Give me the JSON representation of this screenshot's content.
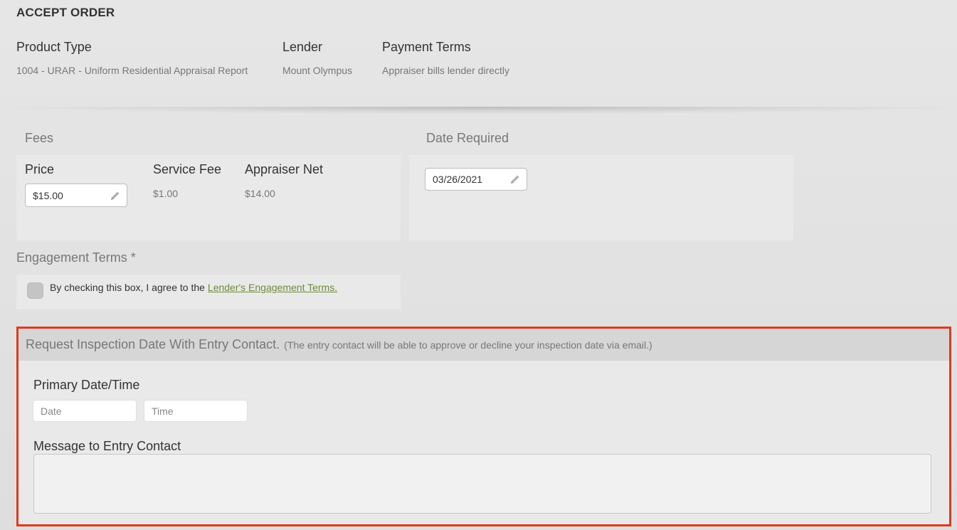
{
  "page": {
    "title": "ACCEPT ORDER"
  },
  "summary": {
    "product_type": {
      "label": "Product Type",
      "value": "1004 - URAR - Uniform Residential Appraisal Report"
    },
    "lender": {
      "label": "Lender",
      "value": "Mount Olympus"
    },
    "payment_terms": {
      "label": "Payment Terms",
      "value": "Appraiser bills lender directly"
    }
  },
  "fees": {
    "section_label": "Fees",
    "price": {
      "label": "Price",
      "value": "$15.00"
    },
    "service_fee": {
      "label": "Service Fee",
      "value": "$1.00"
    },
    "appraiser_net": {
      "label": "Appraiser Net",
      "value": "$14.00"
    }
  },
  "date_required": {
    "section_label": "Date Required",
    "value": "03/26/2021"
  },
  "engagement": {
    "section_label": "Engagement Terms *",
    "agree_text": "By checking this box, I agree to the",
    "link_text": "Lender's Engagement Terms."
  },
  "inspection": {
    "title": "Request Inspection Date With Entry Contact.",
    "note": "(The entry contact will be able to approve or decline your inspection date via email.)",
    "primary_label": "Primary Date/Time",
    "date_placeholder": "Date",
    "time_placeholder": "Time",
    "message_label": "Message to Entry Contact"
  },
  "colors": {
    "accent_red": "#e03a1e",
    "link_green": "#6f8a3a"
  }
}
